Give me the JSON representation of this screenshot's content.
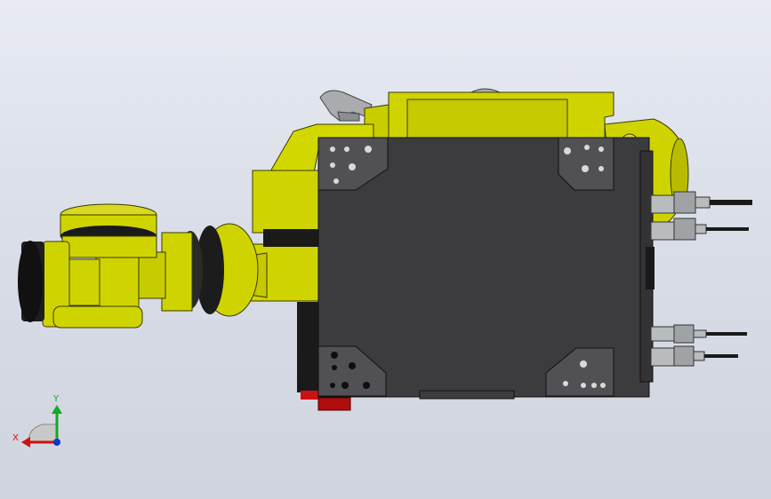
{
  "viewport": {
    "background_top": "#e8ebf2",
    "background_bottom": "#cfd4df"
  },
  "model": {
    "body_color": "#cfd400",
    "plate_color": "#3c3c3f",
    "cable_color": "#1a1a1a",
    "connector_color": "#b9bcbd",
    "accent_red": "#cc1111"
  },
  "triad": {
    "x_label": "X",
    "y_label": "Y",
    "x_color": "#cc1111",
    "y_color": "#11aa22",
    "z_color": "#1133cc"
  }
}
